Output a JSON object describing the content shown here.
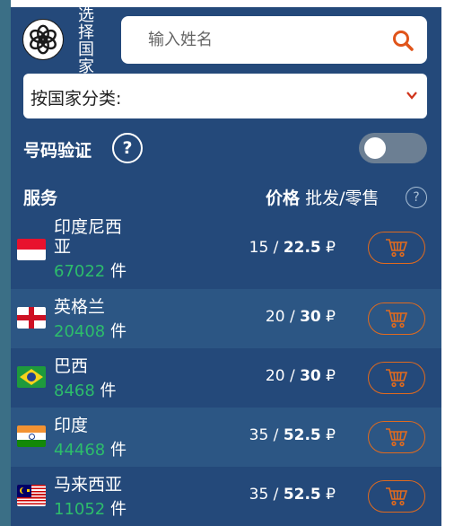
{
  "header": {
    "select_country": "选择国家",
    "search_placeholder": "输入姓名"
  },
  "category": {
    "label": "按国家分类:"
  },
  "verification": {
    "label": "号码验证",
    "help": "?",
    "toggle_on": false
  },
  "table": {
    "service_header": "服务",
    "price_header": "价格",
    "price_sub": "批发/零售",
    "help": "?"
  },
  "rows": [
    {
      "country": "印度尼西亚",
      "count": "67022",
      "unit": "件",
      "wholesale": "15",
      "retail": "22.5",
      "currency": "₽"
    },
    {
      "country": "英格兰",
      "count": "20408",
      "unit": "件",
      "wholesale": "20",
      "retail": "30",
      "currency": "₽"
    },
    {
      "country": "巴西",
      "count": "8468",
      "unit": "件",
      "wholesale": "20",
      "retail": "30",
      "currency": "₽"
    },
    {
      "country": "印度",
      "count": "44468",
      "unit": "件",
      "wholesale": "35",
      "retail": "52.5",
      "currency": "₽"
    },
    {
      "country": "马来西亚",
      "count": "11052",
      "unit": "件",
      "wholesale": "35",
      "retail": "52.5",
      "currency": "₽"
    }
  ],
  "colors": {
    "panel": "#24497a",
    "accent": "#e06a1e",
    "count_green": "#2dbd6b"
  }
}
